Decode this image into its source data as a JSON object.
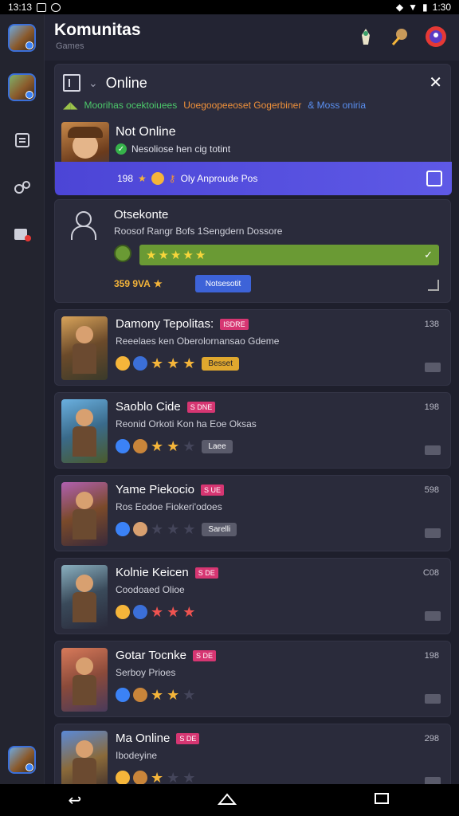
{
  "status_bar": {
    "time_left": "13:13",
    "time_right": "1:30"
  },
  "header": {
    "title": "Komunitas",
    "subtitle": "Games"
  },
  "top_card": {
    "label": "Online",
    "ticker_1": "Moorihas ocektoiuees",
    "ticker_2": "Uoegoopeeoset Gogerbiner",
    "ticker_3": "& Moss oniria",
    "featured_name": "Not Online",
    "featured_status": "Nesoliose hen cig totint",
    "bar_count": "198",
    "bar_text": "Oly Anproude Pos"
  },
  "offline_card": {
    "title": "Otsekonte",
    "subtitle": "Roosof Rangr Bofs 1Sengdern Dossore",
    "score": "359 9VA",
    "button": "Notsesotit"
  },
  "games": [
    {
      "title": "Damony Tepolitas:",
      "tag": "ISDRE",
      "sub": "Reeelaes ken Oberolornansao Gdeme",
      "count": "138",
      "stars": 3,
      "pill": "Besset"
    },
    {
      "title": "Saoblo Cide",
      "tag": "S DNE",
      "sub": "Reonid Orkoti Kon ha Eoe Oksas",
      "count": "198",
      "stars": 2,
      "pill": "Laee"
    },
    {
      "title": "Yame Piekocio",
      "tag": "S UE",
      "sub": "Ros Eodoe Fiokeri'odoes",
      "count": "598",
      "stars": 0,
      "pill": "Sarelli"
    },
    {
      "title": "Kolnie Keicen",
      "tag": "S DE",
      "sub": "Coodoaed Olioe",
      "count": "C08",
      "stars": 3,
      "pill": ""
    },
    {
      "title": "Gotar Tocnke",
      "tag": "S DE",
      "sub": "Serboy Prioes",
      "count": "198",
      "stars": 2,
      "pill": ""
    },
    {
      "title": "Ma Online",
      "tag": "S DE",
      "sub": "Ibodeyine",
      "count": "298",
      "stars": 1,
      "pill": ""
    }
  ],
  "colors": {
    "accent": "#5a55e4",
    "green": "#6a9a34",
    "tag": "#d63672",
    "star": "#f5b53a"
  }
}
